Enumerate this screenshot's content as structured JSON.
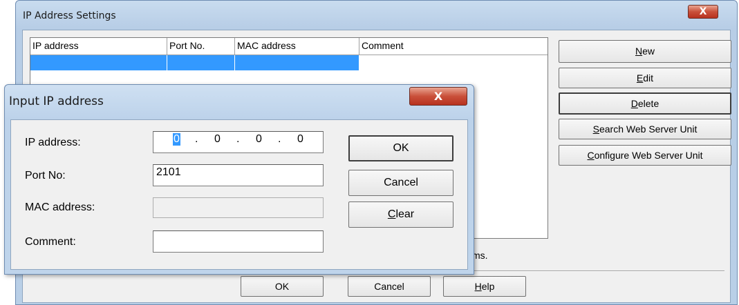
{
  "outer": {
    "title": "IP Address Settings",
    "close_glyph": "X",
    "columns": [
      "IP address",
      "Port No.",
      "MAC address",
      "Comment"
    ],
    "buttons": {
      "new": {
        "pre": "",
        "key": "N",
        "post": "ew"
      },
      "edit": {
        "pre": "",
        "key": "E",
        "post": "dit"
      },
      "delete": {
        "pre": "",
        "key": "D",
        "post": "elete"
      },
      "search": {
        "pre": "",
        "key": "S",
        "post": "earch Web Server Unit"
      },
      "configure": {
        "pre": "",
        "key": "C",
        "post": "onfigure Web Server Unit"
      }
    },
    "hint_tail": "ms.",
    "ok_label": "OK",
    "cancel_label": "Cancel",
    "help": {
      "pre": "",
      "key": "H",
      "post": "elp"
    },
    "selection_color": "#3399ff"
  },
  "dialog": {
    "title": "Input IP address",
    "close_glyph": "X",
    "ip_label": "IP address:",
    "ip_octets": [
      "0",
      "0",
      "0",
      "0"
    ],
    "port_label": "Port No:",
    "port_value": "2101",
    "mac_label": "MAC address:",
    "mac_value": "",
    "comment_label": "Comment:",
    "comment_value": "",
    "ok_label": "OK",
    "cancel_label": "Cancel",
    "clear": {
      "pre": "",
      "key": "C",
      "post": "lear"
    }
  }
}
